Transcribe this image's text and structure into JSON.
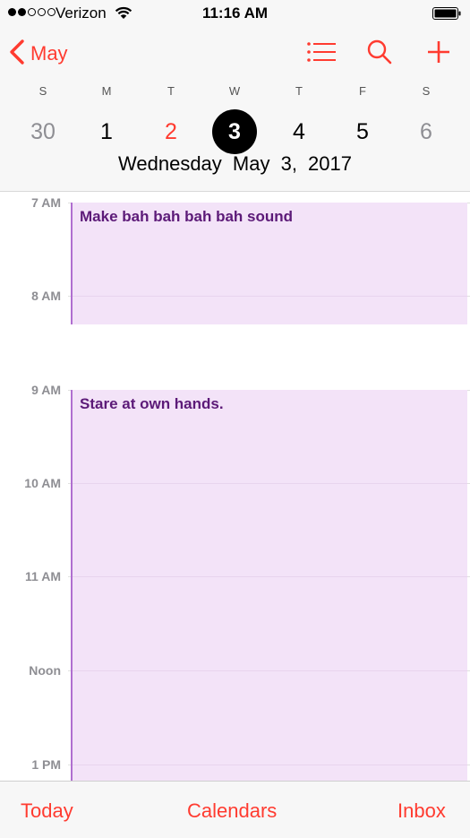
{
  "status_bar": {
    "carrier": "Verizon",
    "time": "11:16 AM",
    "signal_bars_filled": 2,
    "signal_bars_total": 5
  },
  "nav": {
    "back_label": "May",
    "icons": [
      "list-icon",
      "search-icon",
      "add-icon"
    ],
    "accent_color": "#ff3b30"
  },
  "week": {
    "weekday_letters": [
      "S",
      "M",
      "T",
      "W",
      "T",
      "F",
      "S"
    ],
    "dates": [
      "30",
      "1",
      "2",
      "3",
      "4",
      "5",
      "6"
    ],
    "selected_index": 3,
    "today_index": 2,
    "full_date": "Wednesday  May 3, 2017"
  },
  "timeline": {
    "hours": [
      "7 AM",
      "8 AM",
      "9 AM",
      "10 AM",
      "11 AM",
      "Noon",
      "1 PM"
    ],
    "events": [
      {
        "title": "Make bah bah bah bah sound",
        "color": "#b06fd0"
      },
      {
        "title": "Stare at own hands.",
        "color": "#b06fd0"
      }
    ]
  },
  "tab_bar": {
    "today": "Today",
    "calendars": "Calendars",
    "inbox": "Inbox"
  }
}
